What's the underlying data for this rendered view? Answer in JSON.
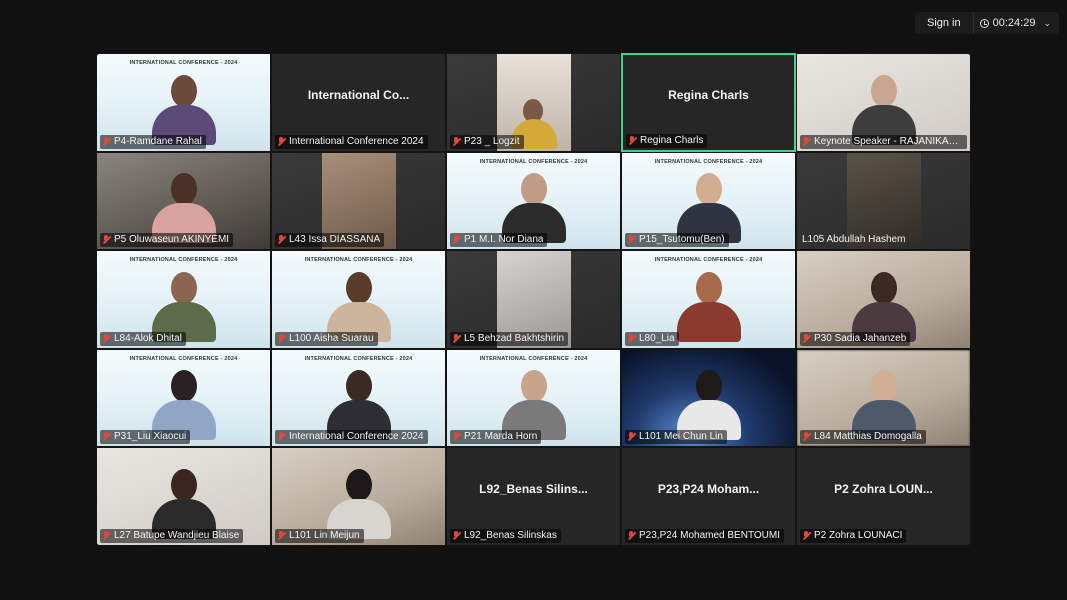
{
  "topbar": {
    "signin_label": "Sign in",
    "timer": "00:24:29"
  },
  "banner_text": "INTERNATIONAL CONFERENCE - 2024",
  "tiles": [
    {
      "label": "P4-Ramdane Rahal"
    },
    {
      "label": "International Conference 2024",
      "center": "International  Co..."
    },
    {
      "label": "P23 _ Logzit"
    },
    {
      "label": "Regina Charls",
      "center": "Regina Charls"
    },
    {
      "label": "Keynote Speaker - RAJANIKANT..."
    },
    {
      "label": "P5 Oluwaseun AKINYEMI"
    },
    {
      "label": "L43 Issa DIASSANA"
    },
    {
      "label": "P1 M.I. Nor Diana"
    },
    {
      "label": "P15_Tsutomu(Ben)"
    },
    {
      "label": "L105  Abdullah Hashem"
    },
    {
      "label": "L84-Alok Dhital"
    },
    {
      "label": "L100 Aisha Suarau"
    },
    {
      "label": "L5 Behzad Bakhtshirin"
    },
    {
      "label": "L80_Lia"
    },
    {
      "label": "P30 Sadia Jahanzeb"
    },
    {
      "label": "P31_Liu Xiaocui"
    },
    {
      "label": "International Conference 2024"
    },
    {
      "label": "P21 Marda Horn"
    },
    {
      "label": "L101 Mei Chun Lin"
    },
    {
      "label": "L84 Matthias Domogalla"
    },
    {
      "label": "L27 Batupe Wandjieu Blaise"
    },
    {
      "label": "L101 Lin Meijun"
    },
    {
      "label": "L92_Benas Silinskas",
      "center": "L92_Benas Silins..."
    },
    {
      "label": "P23,P24 Mohamed BENTOUMI",
      "center": "P23,P24  Moham..."
    },
    {
      "label": "P2 Zohra LOUNACI",
      "center": "P2  Zohra LOUN..."
    }
  ]
}
